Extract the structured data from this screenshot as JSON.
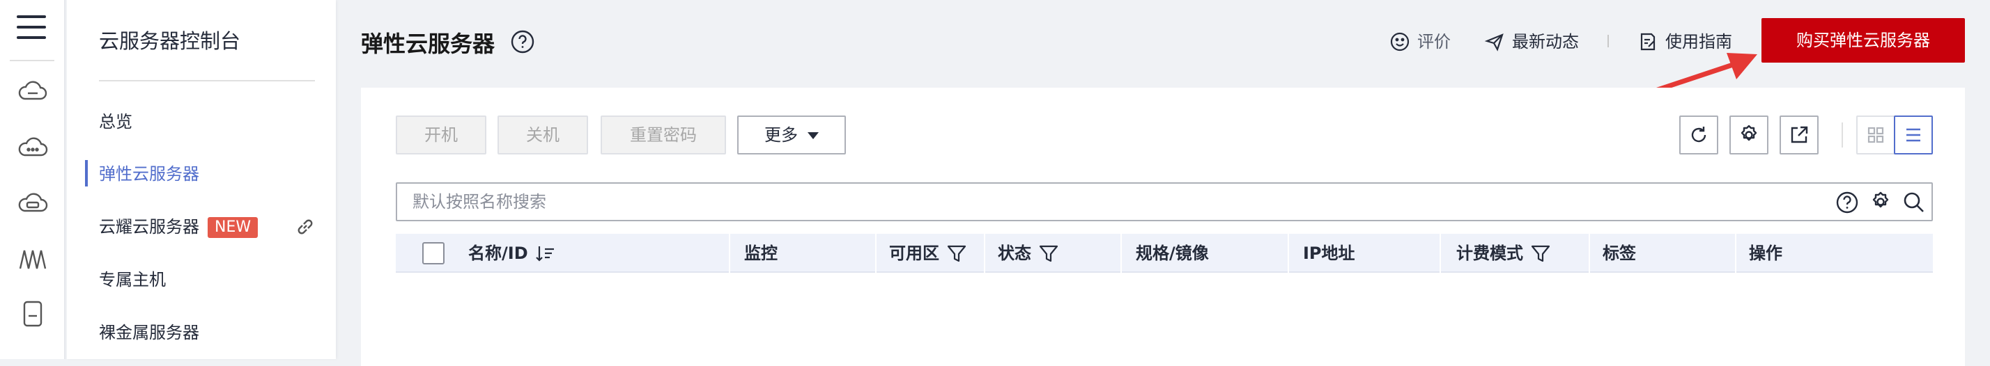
{
  "sidebar": {
    "title": "云服务器控制台",
    "items": [
      {
        "label": "总览"
      },
      {
        "label": "弹性云服务器"
      },
      {
        "label": "云耀云服务器",
        "badge": "NEW"
      },
      {
        "label": "专属主机"
      },
      {
        "label": "裸金属服务器"
      }
    ]
  },
  "header": {
    "title": "弹性云服务器",
    "links": {
      "rate": "评价",
      "news": "最新动态",
      "guide": "使用指南"
    },
    "buy_button": "购买弹性云服务器"
  },
  "toolbar": {
    "start": "开机",
    "stop": "关机",
    "reset_password": "重置密码",
    "more": "更多"
  },
  "search": {
    "placeholder": "默认按照名称搜索"
  },
  "table": {
    "columns": [
      {
        "label": "名称/ID"
      },
      {
        "label": "监控"
      },
      {
        "label": "可用区"
      },
      {
        "label": "状态"
      },
      {
        "label": "规格/镜像"
      },
      {
        "label": "IP地址"
      },
      {
        "label": "计费模式"
      },
      {
        "label": "标签"
      },
      {
        "label": "操作"
      }
    ]
  },
  "colors": {
    "accent": "#526ecc",
    "buy": "#c7000b",
    "badge": "#e5594a",
    "annotation_arrow": "#e53935"
  }
}
